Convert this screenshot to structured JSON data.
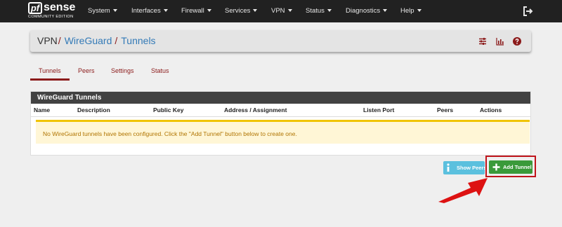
{
  "brand": {
    "logo_pf": "pf",
    "logo_sense": "sense",
    "edition": "COMMUNITY EDITION"
  },
  "nav": {
    "items": [
      {
        "label": "System"
      },
      {
        "label": "Interfaces"
      },
      {
        "label": "Firewall"
      },
      {
        "label": "Services"
      },
      {
        "label": "VPN"
      },
      {
        "label": "Status"
      },
      {
        "label": "Diagnostics"
      },
      {
        "label": "Help"
      }
    ],
    "logout_icon": "sign-out-icon"
  },
  "breadcrumb": {
    "parts": [
      "VPN",
      "WireGuard",
      "Tunnels"
    ],
    "separator": "/",
    "icons": [
      "sliders-icon",
      "bar-chart-icon",
      "help-icon"
    ]
  },
  "tabs": [
    {
      "label": "Tunnels",
      "active": true
    },
    {
      "label": "Peers",
      "active": false
    },
    {
      "label": "Settings",
      "active": false
    },
    {
      "label": "Status",
      "active": false
    }
  ],
  "panel": {
    "title": "WireGuard Tunnels",
    "columns": [
      "Name",
      "Description",
      "Public Key",
      "Address / Assignment",
      "Listen Port",
      "Peers",
      "Actions"
    ],
    "empty_message": "No WireGuard tunnels have been configured. Click the \"Add Tunnel\" button below to create one."
  },
  "buttons": {
    "show_peers": "Show Peers",
    "add_tunnel": "Add Tunnel"
  },
  "colors": {
    "navbar": "#212121",
    "accent_red": "#8b1a1a",
    "link_blue": "#337ab7",
    "warning_bg": "#fff6d6",
    "warning_border": "#f0c400",
    "success": "#3a9a3a",
    "info": "#5bc0de",
    "annotation_red": "#c0141c"
  }
}
